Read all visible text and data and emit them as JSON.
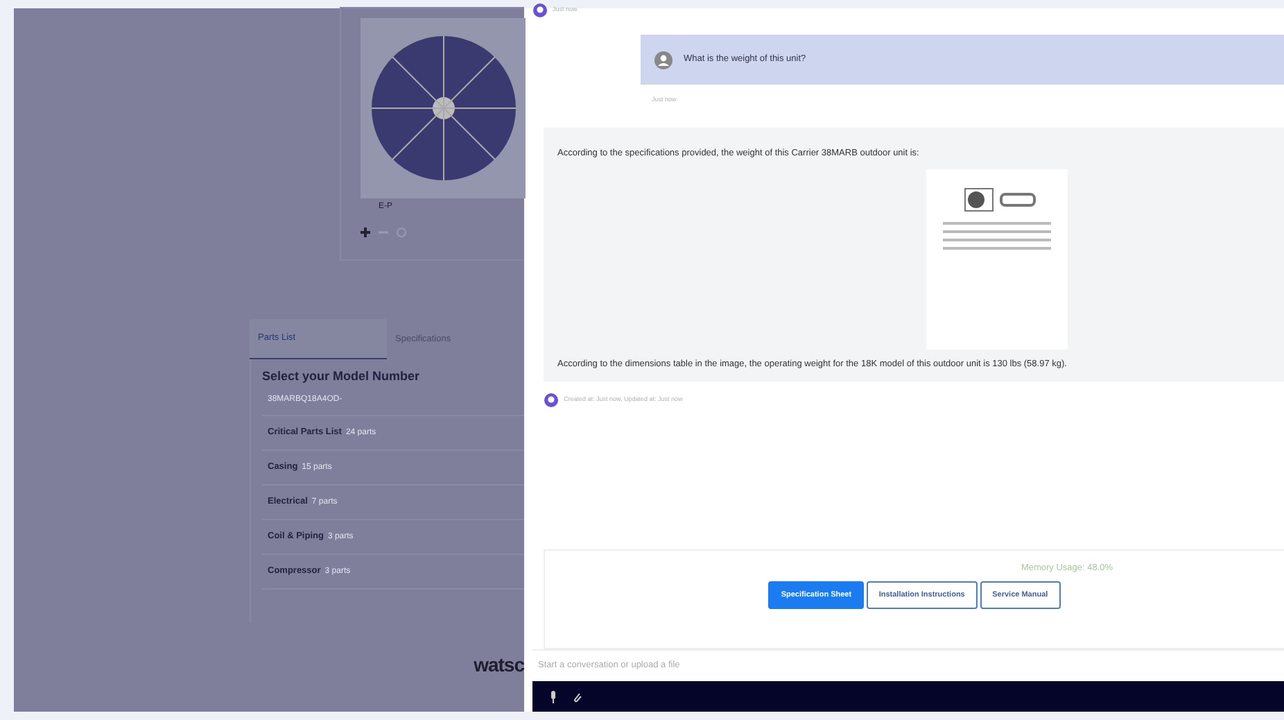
{
  "product_panel": {
    "image_caption": "E-P",
    "tabs": [
      {
        "label": "Parts List",
        "selected": true
      },
      {
        "label": "Specifications",
        "selected": false
      }
    ],
    "heading": "Select your Model Number",
    "model_select": {
      "value": "38MARBQ18A4OD-"
    },
    "categories": [
      {
        "name": "Critical Parts List",
        "count": "24 parts"
      },
      {
        "name": "Casing",
        "count": "15 parts"
      },
      {
        "name": "Electrical",
        "count": "7 parts"
      },
      {
        "name": "Coil & Piping",
        "count": "3 parts"
      },
      {
        "name": "Compressor",
        "count": "3 parts"
      }
    ],
    "logo": "watsc"
  },
  "chat": {
    "top_meta": "Just now",
    "messages": [
      {
        "kind": "user",
        "text": "What is the weight of this unit?",
        "meta": "Just now"
      },
      {
        "kind": "assistant",
        "text": "According to the specifications provided, the weight of this Carrier 38MARB outdoor unit is:",
        "after": "According to the dimensions table in the image, the operating weight for the 18K model of this outdoor unit is 130 lbs (58.97 kg).",
        "meta": "Created at: Just now, Updated at: Just now"
      }
    ],
    "memory_usage": "Memory Usage: 48.0%",
    "documents": [
      {
        "label": "Specification Sheet",
        "selected": true
      },
      {
        "label": "Installation Instructions",
        "selected": false
      },
      {
        "label": "Service Manual",
        "selected": false
      }
    ],
    "input": {
      "placeholder": "Start a conversation or upload a file"
    }
  }
}
